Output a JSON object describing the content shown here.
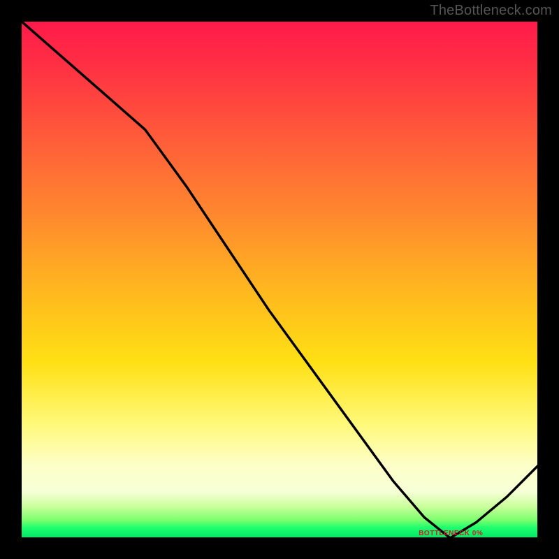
{
  "watermark": "TheBottleneck.com",
  "bottom_label": "BOTTLENECK 0%",
  "chart_data": {
    "type": "line",
    "title": "",
    "xlabel": "",
    "ylabel": "",
    "xlim": [
      0,
      1
    ],
    "ylim": [
      0,
      1
    ],
    "series": [
      {
        "name": "bottleneck-curve",
        "x": [
          0.0,
          0.08,
          0.16,
          0.24,
          0.32,
          0.4,
          0.48,
          0.56,
          0.64,
          0.72,
          0.78,
          0.83,
          0.88,
          0.94,
          1.0
        ],
        "y": [
          1.0,
          0.93,
          0.86,
          0.79,
          0.68,
          0.56,
          0.44,
          0.33,
          0.22,
          0.11,
          0.04,
          0.0,
          0.03,
          0.08,
          0.14
        ]
      }
    ],
    "annotations": [
      {
        "text_key": "bottom_label",
        "x": 0.83,
        "y": 0.0
      }
    ],
    "gradient_stops": [
      {
        "pos": 0.0,
        "color": "#ff1a4b"
      },
      {
        "pos": 0.5,
        "color": "#ffc51a"
      },
      {
        "pos": 0.85,
        "color": "#fdffc9"
      },
      {
        "pos": 1.0,
        "color": "#00e765"
      }
    ]
  }
}
